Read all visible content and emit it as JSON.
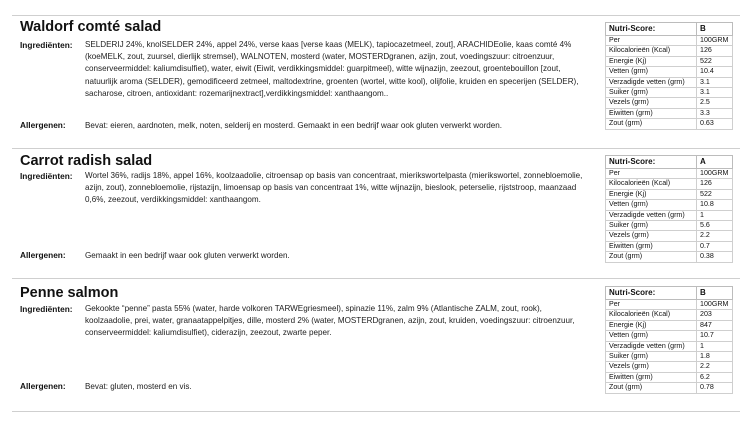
{
  "products": [
    {
      "name": "Waldorf comté salad",
      "ingredients_label": "Ingrediënten:",
      "ingredients_lines": [
        "SELDERIJ 24%, knolSELDER 24%, appel 24%, verse kaas [verse kaas (MELK), tapiocazetmeel, zout], ARACHIDEolie, kaas comté 4%",
        "(koeMELK, zout, zuursel, dierlijk stremsel), WALNOTEN, mosterd (water, MOSTERDgranen, azijn, zout, voedingszuur: citroenzuur,",
        "conserveermiddel: kaliumdisulfiet), water, eiwit (Eiwit, verdikkingsmiddel: guarpitmeel), witte wijnazijn, zeezout, groentebouillon [zout,",
        "natuurlijk aroma (SELDER), gemodificeerd zetmeel, maltodextrine, groenten (wortel, witte kool), olijfolie, kruiden en specerijen (SELDER),",
        "sacharose, citroen, antioxidant: rozemarijnextract],verdikkingsmiddel: xanthaangom.."
      ],
      "allergens_label": "Allergenen:",
      "allergens": "Bevat: eieren, aardnoten, melk, noten, selderij en mosterd. Gemaakt in een bedrijf waar ook gluten verwerkt worden.",
      "nutri": {
        "label": "Nutri-Score:",
        "score": "B",
        "rows": [
          {
            "k": "Per",
            "v": "100GRM"
          },
          {
            "k": "Kilocalorieën (Kcal)",
            "v": "126"
          },
          {
            "k": "Energie (Kj)",
            "v": "522"
          },
          {
            "k": "Vetten (grm)",
            "v": "10.4"
          },
          {
            "k": "Verzadigde vetten (grm)",
            "v": "3.1"
          },
          {
            "k": "Suiker (grm)",
            "v": "3.1"
          },
          {
            "k": "Vezels (grm)",
            "v": "2.5"
          },
          {
            "k": "Eiwitten (grm)",
            "v": "3.3"
          },
          {
            "k": "Zout (grm)",
            "v": "0.63"
          }
        ]
      }
    },
    {
      "name": "Carrot radish salad",
      "ingredients_label": "Ingrediënten:",
      "ingredients_lines": [
        "Wortel 36%, radijs 18%, appel 16%, koolzaadolie, citroensap op basis van concentraat, mierikswortelpasta (mierikswortel, zonnebloemolie,",
        "azijn, zout), zonnebloemolie, rijstazijn, limoensap op basis van concentraat 1%, witte wijnazijn, bieslook, peterselie, rijststroop, maanzaad",
        "0,6%, zeezout, verdikkingsmiddel: xanthaangom."
      ],
      "allergens_label": "Allergenen:",
      "allergens": "Gemaakt in een bedrijf waar ook gluten verwerkt worden.",
      "nutri": {
        "label": "Nutri-Score:",
        "score": "A",
        "rows": [
          {
            "k": "Per",
            "v": "100GRM"
          },
          {
            "k": "Kilocalorieën (Kcal)",
            "v": "126"
          },
          {
            "k": "Energie (Kj)",
            "v": "522"
          },
          {
            "k": "Vetten (grm)",
            "v": "10.8"
          },
          {
            "k": "Verzadigde vetten (grm)",
            "v": "1"
          },
          {
            "k": "Suiker (grm)",
            "v": "5.6"
          },
          {
            "k": "Vezels (grm)",
            "v": "2.2"
          },
          {
            "k": "Eiwitten (grm)",
            "v": "0.7"
          },
          {
            "k": "Zout (grm)",
            "v": "0.38"
          }
        ]
      }
    },
    {
      "name": "Penne salmon",
      "ingredients_label": "Ingrediënten:",
      "ingredients_lines": [
        "Gekookte “penne” pasta 55% (water, harde volkoren TARWEgriesmeel), spinazie 11%, zalm 9% (Atlantische ZALM, zout, rook),",
        "koolzaadolie, prei, water, granaatappelpitjes, dille, mosterd 2% (water, MOSTERDgranen, azijn, zout, kruiden, voedingszuur: citroenzuur,",
        "conserveermiddel: kaliumdisulfiet), ciderazijn, zeezout, zwarte peper."
      ],
      "allergens_label": "Allergenen:",
      "allergens": "Bevat: gluten, mosterd en vis.",
      "nutri": {
        "label": "Nutri-Score:",
        "score": "B",
        "rows": [
          {
            "k": "Per",
            "v": "100GRM"
          },
          {
            "k": "Kilocalorieën (Kcal)",
            "v": "203"
          },
          {
            "k": "Energie (Kj)",
            "v": "847"
          },
          {
            "k": "Vetten (grm)",
            "v": "10.7"
          },
          {
            "k": "Verzadigde vetten (grm)",
            "v": "1"
          },
          {
            "k": "Suiker (grm)",
            "v": "1.8"
          },
          {
            "k": "Vezels (grm)",
            "v": "2.2"
          },
          {
            "k": "Eiwitten (grm)",
            "v": "6.2"
          },
          {
            "k": "Zout (grm)",
            "v": "0.78"
          }
        ]
      }
    }
  ]
}
